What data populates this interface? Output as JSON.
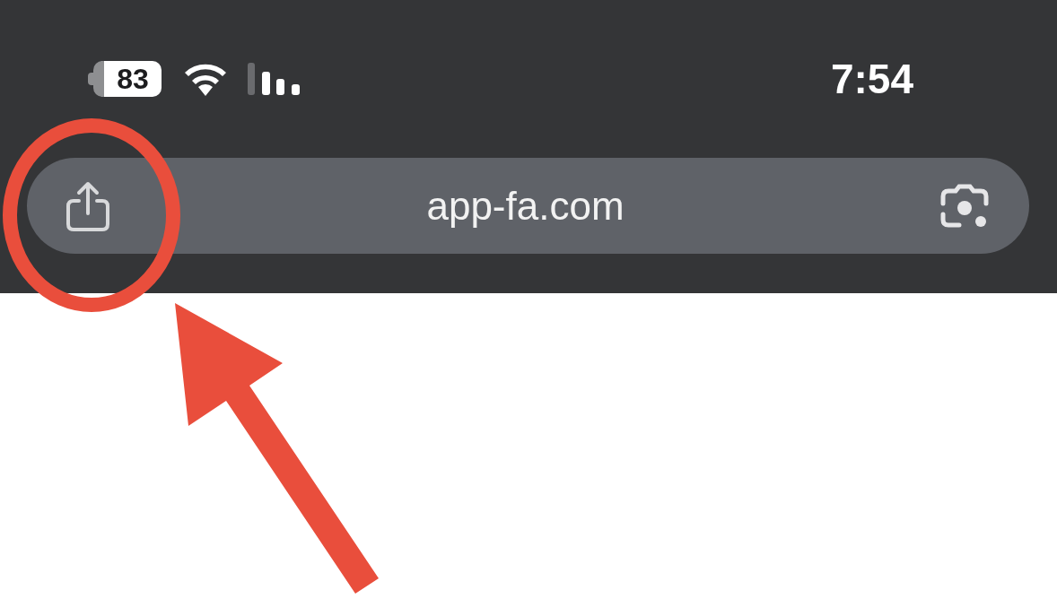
{
  "status_bar": {
    "battery": "83",
    "time": "7:54"
  },
  "address_bar": {
    "url": "app-fa.com"
  }
}
